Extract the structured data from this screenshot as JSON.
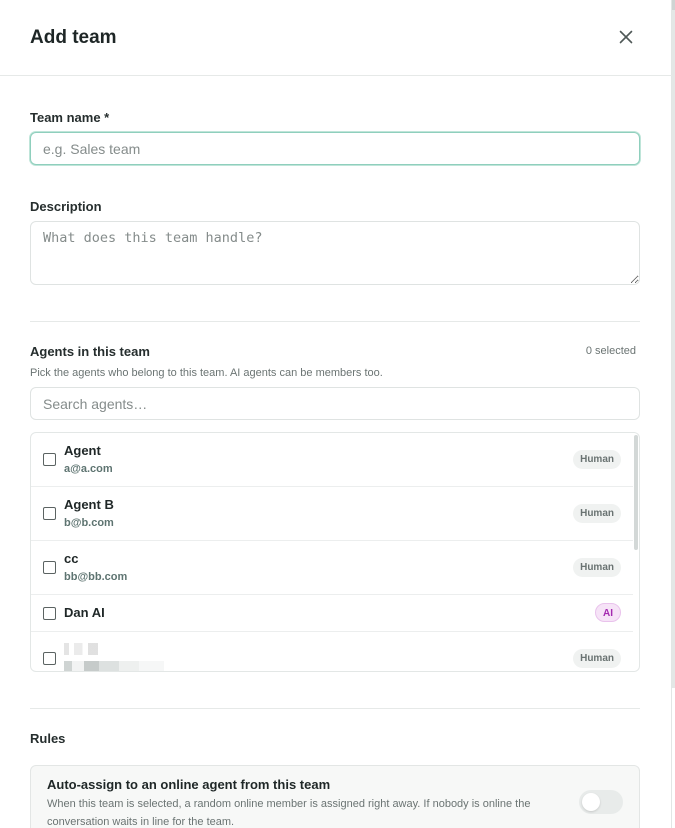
{
  "dialog": {
    "title": "Add team",
    "close_icon": "close-icon"
  },
  "form": {
    "team_name": {
      "label": "Team name *",
      "value": "",
      "placeholder": "e.g. Sales team"
    },
    "description": {
      "label": "Description",
      "value": "",
      "placeholder": "What does this team handle?"
    }
  },
  "agents": {
    "label": "Agents in this team",
    "selected_count": "0 selected",
    "helper": "Pick the agents who belong to this team. AI agents can be members too.",
    "search_placeholder": "Search agents…",
    "items": [
      {
        "name": "Agent",
        "email": "a@a.com",
        "type": "Human",
        "checked": false
      },
      {
        "name": "Agent B",
        "email": "b@b.com",
        "type": "Human",
        "checked": false
      },
      {
        "name": "cc",
        "email": "bb@bb.com",
        "type": "Human",
        "checked": false
      },
      {
        "name": "Dan AI",
        "email": "",
        "type": "AI",
        "checked": false
      },
      {
        "name": "",
        "email": "",
        "type": "Human",
        "checked": false,
        "redacted": true
      }
    ]
  },
  "rules": {
    "title": "Rules",
    "auto_assign": {
      "title": "Auto-assign to an online agent from this team",
      "description": "When this team is selected, a random online member is assigned right away. If nobody is online the conversation waits in line for the team.",
      "enabled": false
    }
  },
  "colors": {
    "focus_border": "#8fcfbd",
    "ai_badge_bg": "#f6e3f7",
    "ai_badge_text": "#a42ab0",
    "human_badge_bg": "#f0f2f1"
  }
}
